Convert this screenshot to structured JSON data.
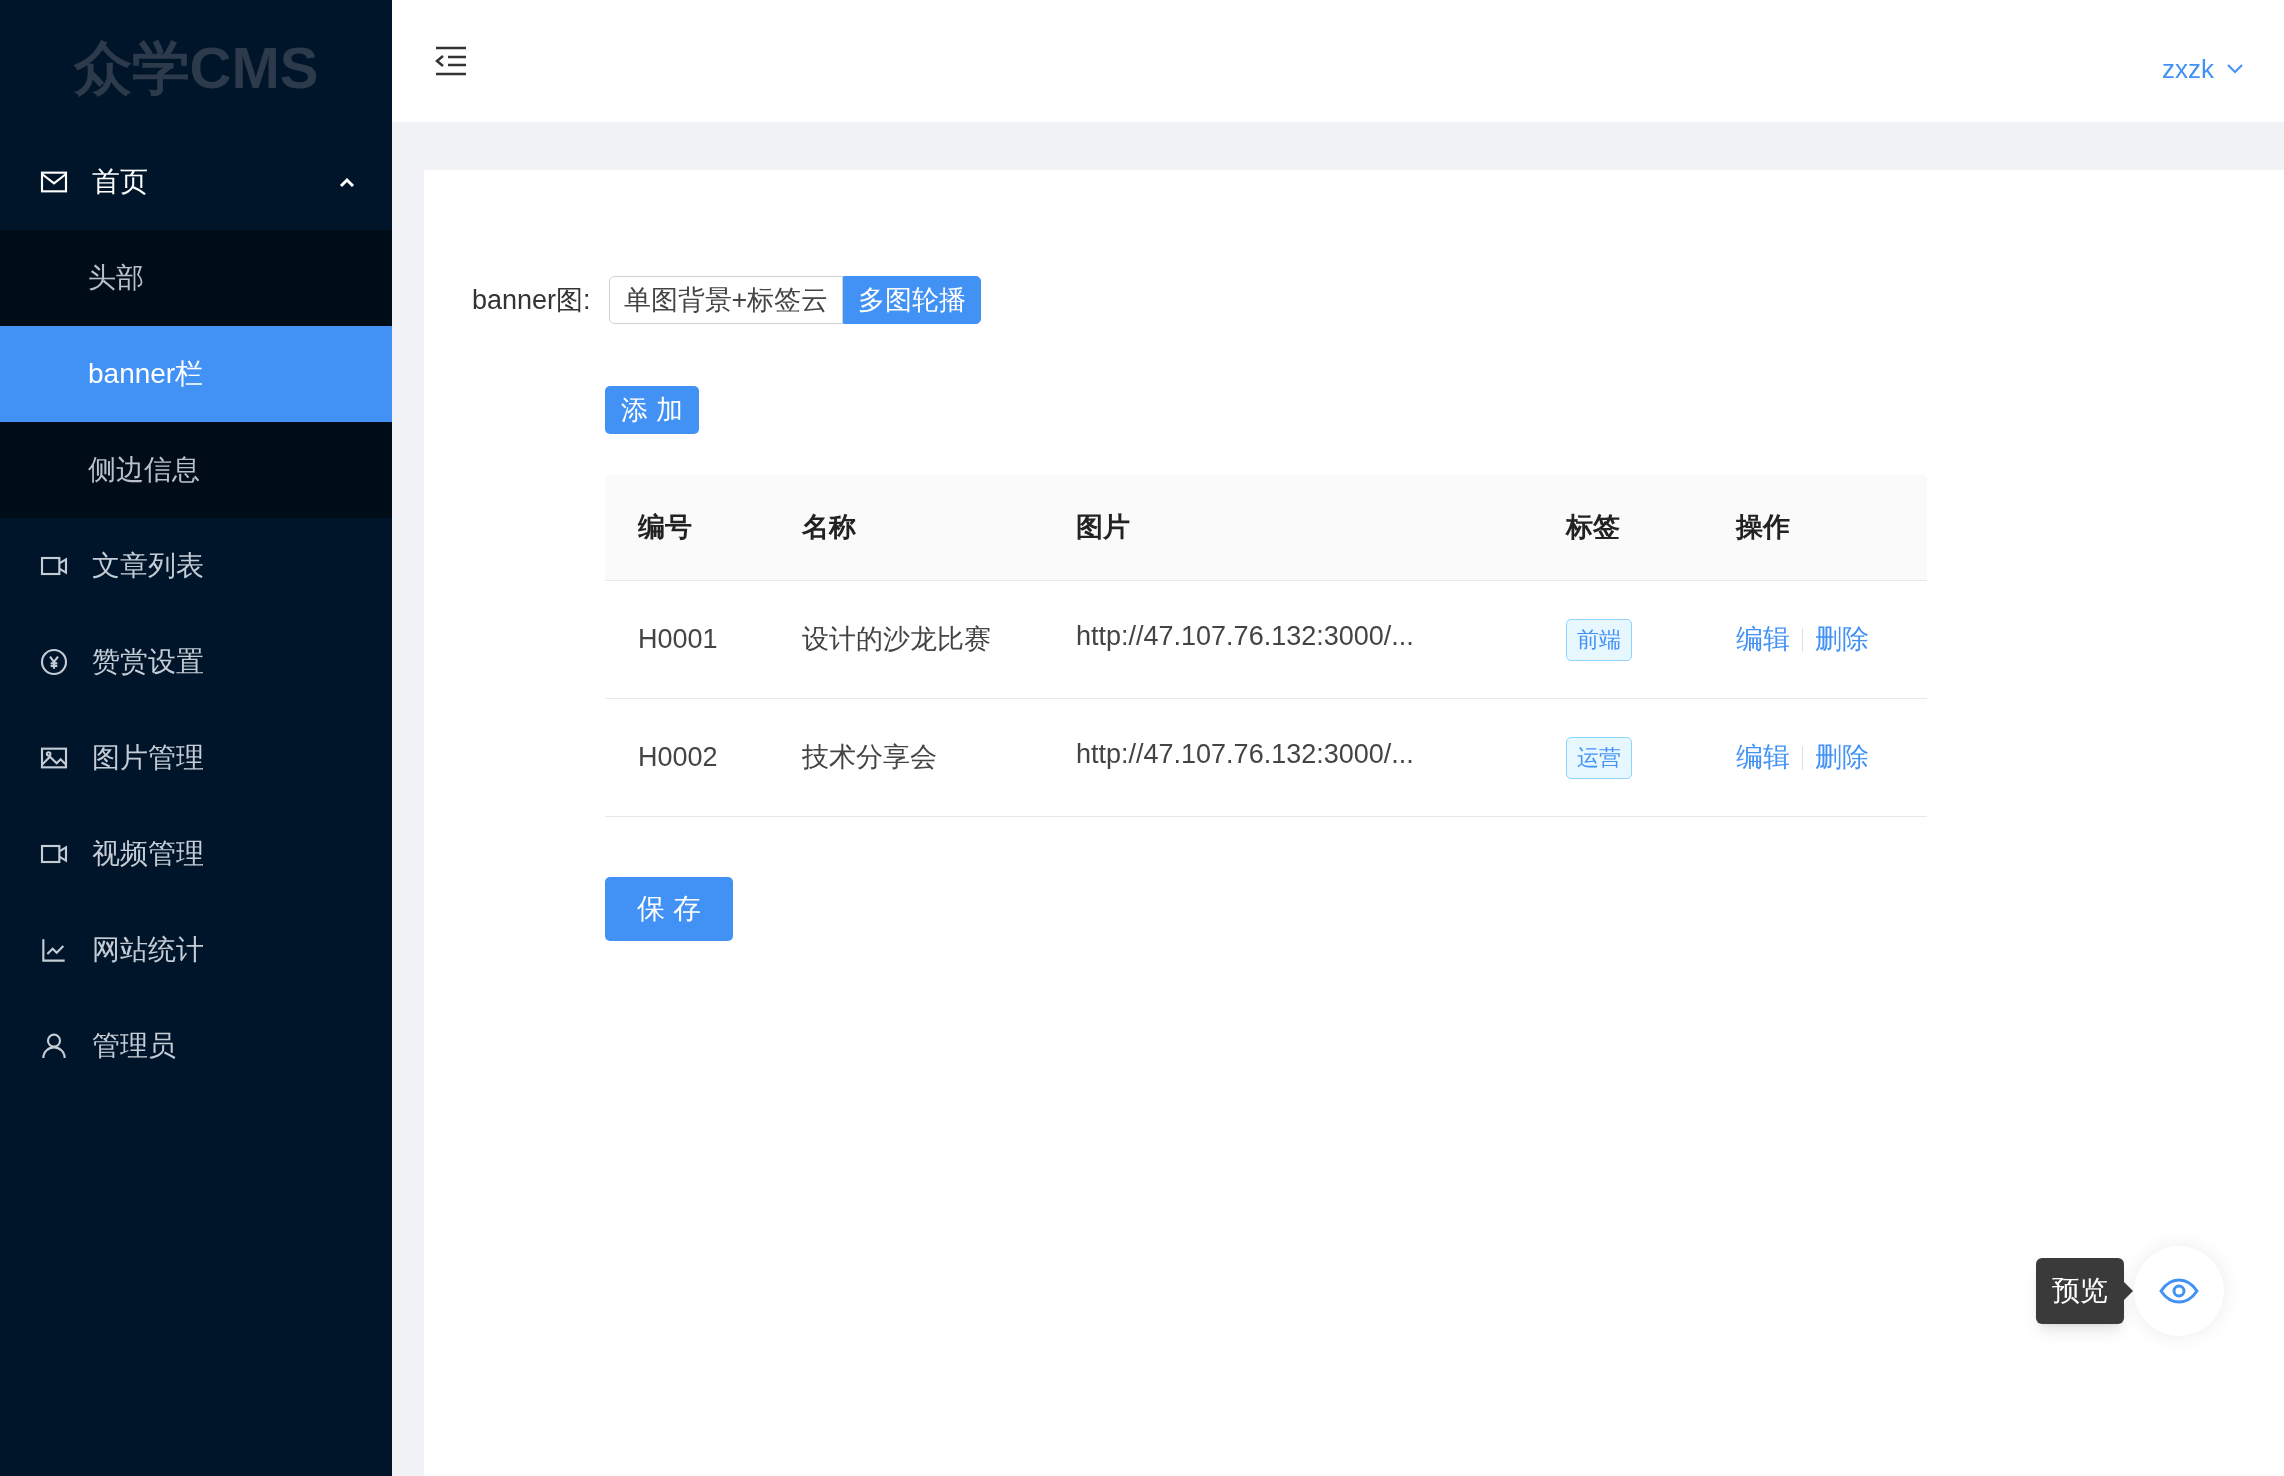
{
  "logo": "众学CMS",
  "menu": [
    {
      "label": "首页",
      "selected": false,
      "expanded": true,
      "children": [
        {
          "label": "头部",
          "selected": false
        },
        {
          "label": "banner栏",
          "selected": true
        },
        {
          "label": "侧边信息",
          "selected": false
        }
      ]
    },
    {
      "label": "文章列表",
      "selected": false
    },
    {
      "label": "赞赏设置",
      "selected": false
    },
    {
      "label": "图片管理",
      "selected": false
    },
    {
      "label": "视频管理",
      "selected": false
    },
    {
      "label": "网站统计",
      "selected": false
    },
    {
      "label": "管理员",
      "selected": false
    }
  ],
  "user": "zxzk",
  "banner_field": {
    "label": "banner图:",
    "options": [
      {
        "label": "单图背景+标签云",
        "selected": false
      },
      {
        "label": "多图轮播",
        "selected": true
      }
    ]
  },
  "add_button": "添 加",
  "table": {
    "columns": [
      "编号",
      "名称",
      "图片",
      "标签",
      "操作"
    ],
    "rows": [
      {
        "id": "H0001",
        "name": "设计的沙龙比赛",
        "image": "http://47.107.76.132:3000/...",
        "tag": "前端",
        "actions": [
          "编辑",
          "删除"
        ]
      },
      {
        "id": "H0002",
        "name": "技术分享会",
        "image": "http://47.107.76.132:3000/...",
        "tag": "运营",
        "actions": [
          "编辑",
          "删除"
        ]
      }
    ]
  },
  "save_button": "保 存",
  "preview_tooltip": "预览"
}
